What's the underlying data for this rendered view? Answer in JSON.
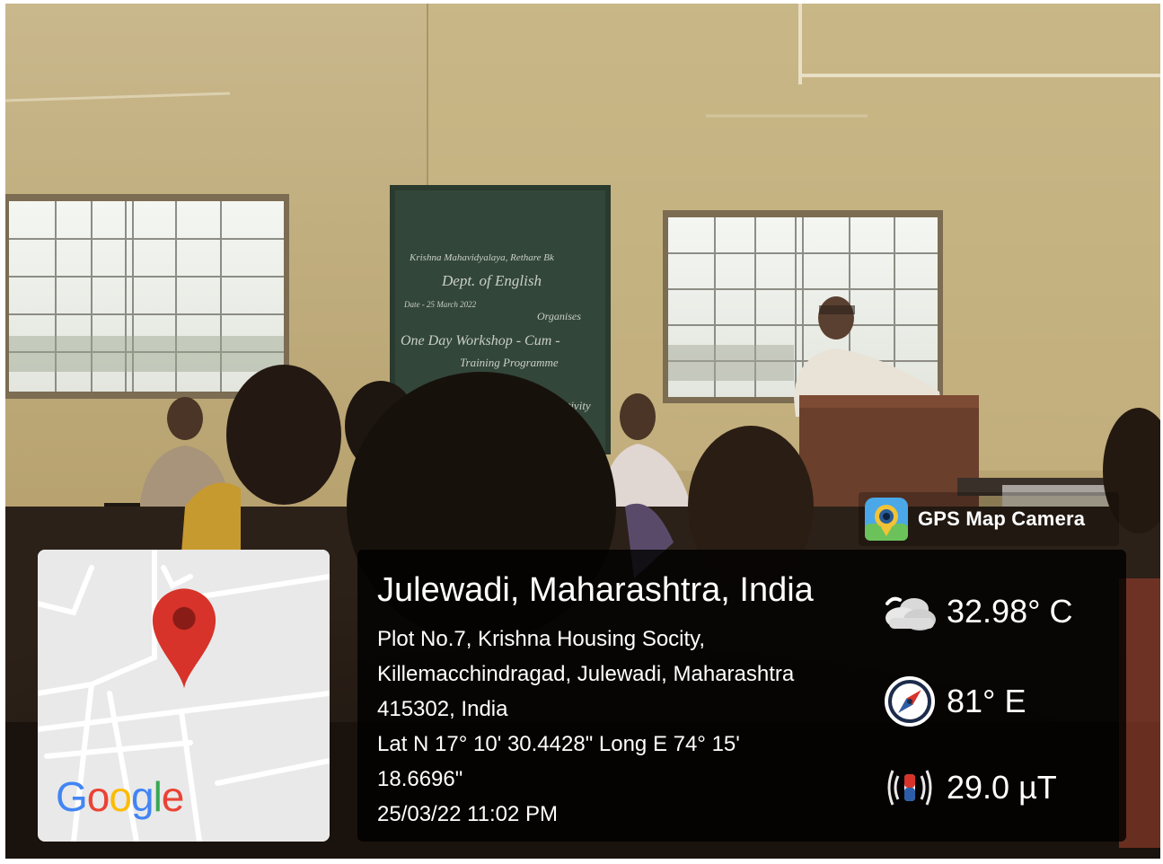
{
  "photo": {
    "subject": "classroom-lecture-scene"
  },
  "blackboard": {
    "lines": [
      "Krishna Mahavidyalaya, Rethare Bk",
      "Dept. of English",
      "Date - 25 March 2022",
      "Organises",
      "One Day Workshop - Cum -",
      "Training Programme",
      "Activity"
    ]
  },
  "brand": {
    "label": "GPS Map Camera",
    "logo_icon": "gps-map-camera-logo"
  },
  "map": {
    "logo_text": "Google",
    "pin_color": "#d7332a",
    "pin_icon": "map-pin-icon"
  },
  "location": {
    "title": "Julewadi, Maharashtra, India",
    "address_lines": [
      "Plot No.7, Krishna Housing Socity,",
      "Killemacchindragad, Julewadi, Maharashtra",
      "415302, India",
      "Lat N 17° 10' 30.4428\" Long E 74° 15'",
      "18.6696\"",
      "25/03/22 11:02 PM"
    ]
  },
  "metrics": {
    "temperature": {
      "value": "32.98° C",
      "icon": "cloud-weather-icon"
    },
    "direction": {
      "value": "81° E",
      "icon": "compass-icon"
    },
    "magnetic": {
      "value": "29.0 µT",
      "icon": "magnet-icon"
    }
  }
}
